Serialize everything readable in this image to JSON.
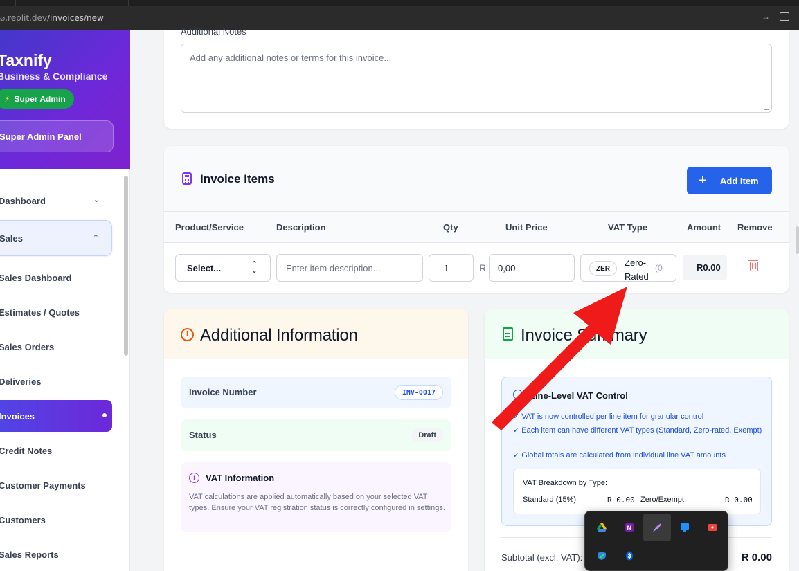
{
  "browser": {
    "url_prefix": ".replit.dev",
    "url_path": "/invoices/new"
  },
  "sidebar": {
    "brand": "Taxnify",
    "tagline": "Business & Compliance",
    "role_badge": "Super Admin",
    "admin_panel": "Super Admin Panel",
    "items": [
      {
        "label": "Dashboard",
        "state": "collapsed"
      },
      {
        "label": "Sales",
        "state": "expanded"
      },
      {
        "label": "Sales Dashboard"
      },
      {
        "label": "Estimates / Quotes"
      },
      {
        "label": "Sales Orders"
      },
      {
        "label": "Deliveries"
      },
      {
        "label": "Invoices",
        "state": "active"
      },
      {
        "label": "Credit Notes"
      },
      {
        "label": "Customer Payments"
      },
      {
        "label": "Customers"
      },
      {
        "label": "Sales Reports"
      }
    ]
  },
  "notes": {
    "label": "Additional Notes",
    "placeholder": "Add any additional notes or terms for this invoice..."
  },
  "items": {
    "title": "Invoice Items",
    "add_label": "Add Item",
    "columns": [
      "Product/Service",
      "Description",
      "Qty",
      "Unit Price",
      "VAT Type",
      "Amount",
      "Remove"
    ],
    "row": {
      "product": "Select...",
      "description_placeholder": "Enter item description...",
      "qty": "1",
      "currency": "R",
      "unit_price": "0,00",
      "vat_code": "ZER",
      "vat_label": "Zero-Rated",
      "vat_extra": "(0",
      "amount": "R0.00"
    }
  },
  "additional": {
    "title": "Additional Information",
    "invoice_number_label": "Invoice Number",
    "invoice_number": "INV-0017",
    "status_label": "Status",
    "status": "Draft",
    "vat_title": "VAT Information",
    "vat_body": "VAT calculations are applied automatically based on your selected VAT types. Ensure your VAT registration status is correctly configured in settings."
  },
  "summary": {
    "title": "Invoice Summary",
    "control_title": "Line-Level VAT Control",
    "bullets": [
      "✓ VAT is now controlled per line item for granular control",
      "✓ Each item can have different VAT types (Standard, Zero-rated, Exempt)",
      "✓ Global totals are calculated from individual line VAT amounts"
    ],
    "breakdown_title": "VAT Breakdown by Type:",
    "standard_label": "Standard (15%):",
    "standard_value": "R 0.00",
    "zero_label": "Zero/Exempt:",
    "zero_value": "R 0.00",
    "subtotal_label": "Subtotal (excl. VAT):",
    "subtotal_value": "R 0.00"
  },
  "tray_icons": [
    "google-drive-icon",
    "onenote-icon",
    "feather-app-icon",
    "blue-app-icon",
    "anydesk-icon",
    "defender-icon",
    "bluetooth-icon"
  ],
  "colors": {
    "accent": "#2563eb",
    "brand_gradient_start": "#4338ca",
    "brand_gradient_end": "#7e22ce",
    "annotation": "#ef1b1b"
  }
}
